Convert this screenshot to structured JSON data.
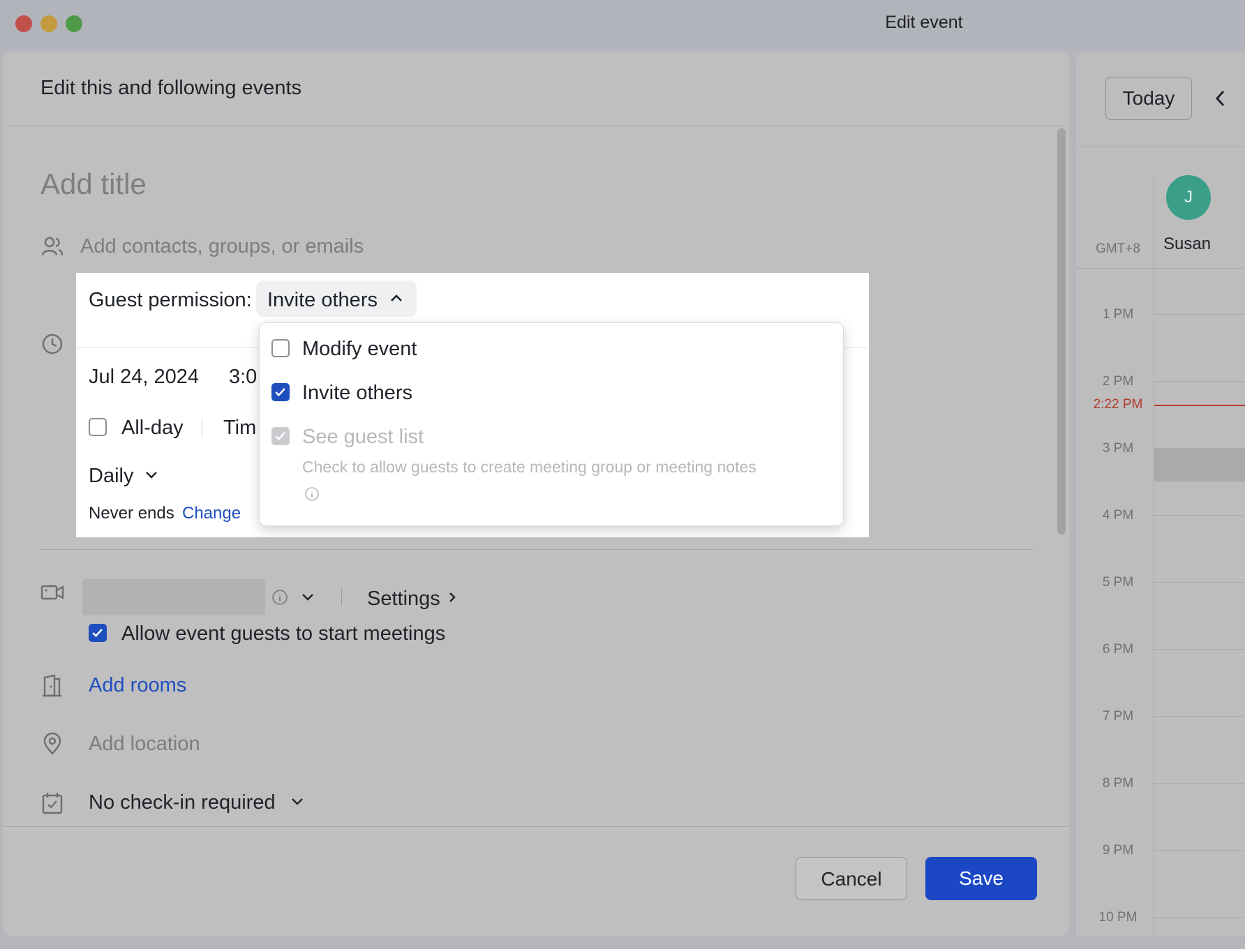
{
  "window": {
    "title": "Edit event"
  },
  "modal": {
    "header_title": "Edit this and following events",
    "title_placeholder": "Add title",
    "guests_placeholder": "Add contacts, groups, or emails",
    "guest_permission": {
      "label": "Guest permission:",
      "selected": "Invite others",
      "options": [
        {
          "label": "Modify event",
          "checked": false,
          "disabled": false
        },
        {
          "label": "Invite others",
          "checked": true,
          "disabled": false
        },
        {
          "label": "See guest list",
          "checked": true,
          "disabled": true
        }
      ],
      "hint": "Check to allow guests to create meeting group or meeting notes"
    },
    "date": "Jul 24, 2024",
    "time_partial": "3:0",
    "all_day_label": "All-day",
    "timezone_partial": "Tim",
    "recurrence": "Daily",
    "ends_text": "Never ends",
    "change_link": "Change",
    "video": {
      "settings_label": "Settings",
      "allow_guests_label": "Allow event guests to start meetings",
      "allow_guests_checked": true
    },
    "add_rooms": "Add rooms",
    "location_placeholder": "Add location",
    "checkin": "No check-in required",
    "cancel_label": "Cancel",
    "save_label": "Save"
  },
  "calendar": {
    "today_label": "Today",
    "timezone": "GMT+8",
    "attendee": {
      "initial": "J",
      "name": "Susan"
    },
    "hours": [
      "1 PM",
      "2 PM",
      "3 PM",
      "4 PM",
      "5 PM",
      "6 PM",
      "7 PM",
      "8 PM",
      "9 PM",
      "10 PM"
    ],
    "current_time": "2:22 PM"
  },
  "colors": {
    "accent": "#1b47c4",
    "link": "#1f4fbf",
    "now_line": "#b23a30",
    "avatar": "#3a9e88"
  }
}
